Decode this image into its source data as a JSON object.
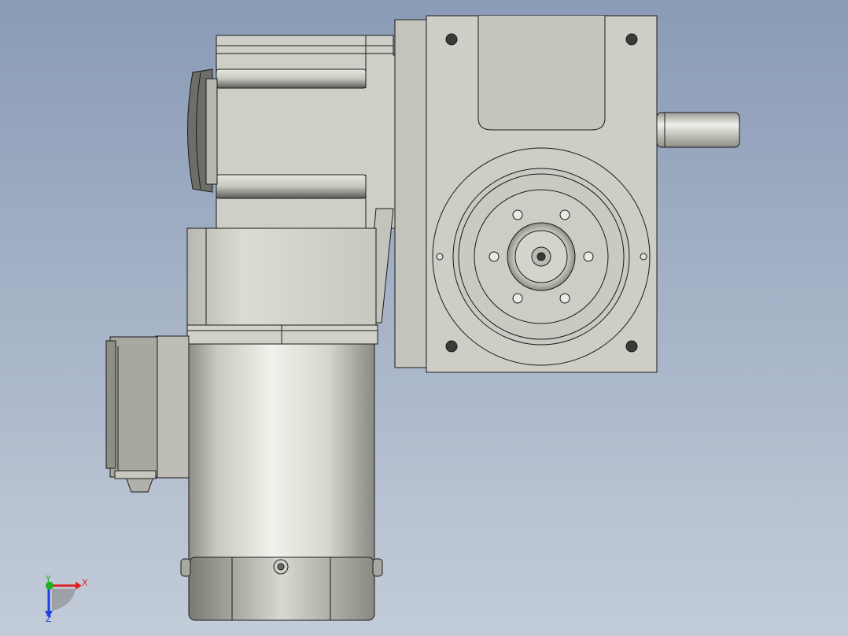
{
  "viewport": {
    "background_top": "#8a9bb6",
    "background_bottom": "#c3ccd9"
  },
  "model": {
    "part_color": "#cfcfc8",
    "edge_color": "#1a1a1a"
  },
  "triad": {
    "x_label": "X",
    "y_label": "Y",
    "z_label": "Z",
    "x_color": "#e02020",
    "y_color": "#20b020",
    "z_color": "#2040e0"
  }
}
